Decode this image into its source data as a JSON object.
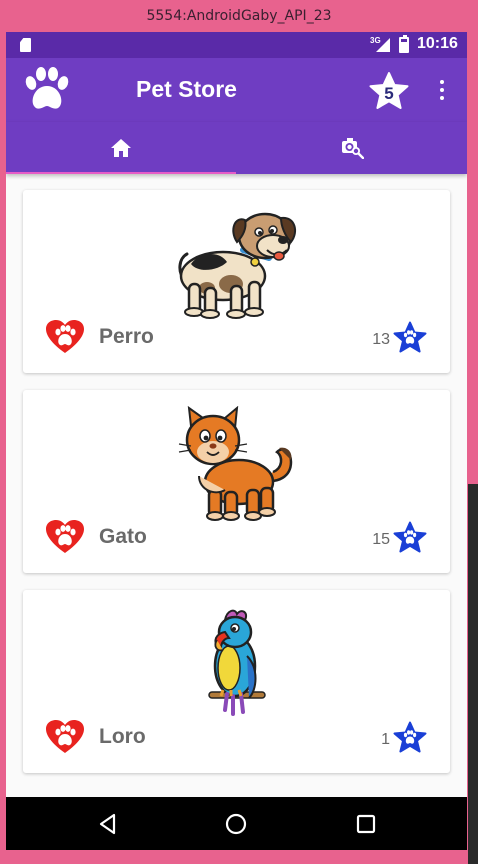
{
  "window": {
    "title": "5554:AndroidGaby_API_23"
  },
  "status_bar": {
    "network": "3G",
    "time": "10:16"
  },
  "app_bar": {
    "title": "Pet Store",
    "rating_badge": "5"
  },
  "tabs": [
    {
      "icon": "home-icon",
      "selected": true
    },
    {
      "icon": "photo-search-icon",
      "selected": false
    }
  ],
  "pets": [
    {
      "name": "Perro",
      "likes": "13",
      "image": "dog-illustration"
    },
    {
      "name": "Gato",
      "likes": "15",
      "image": "cat-illustration"
    },
    {
      "name": "Loro",
      "likes": "1",
      "image": "parrot-illustration"
    }
  ],
  "colors": {
    "primary": "#6f3dc2",
    "primary_dark": "#5a2aa8",
    "tab_indicator": "#e65bc7",
    "heart": "#e8231f",
    "like_star": "#1a3fd6",
    "frame": "#e8628e"
  }
}
